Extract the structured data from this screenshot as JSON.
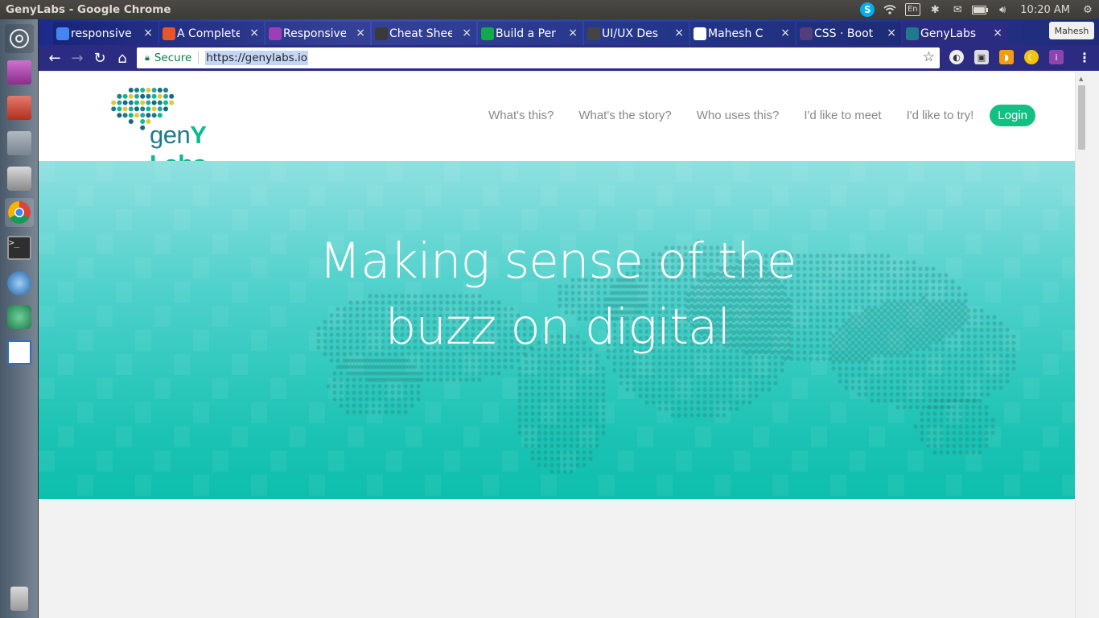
{
  "os": {
    "window_title": "GenyLabs - Google Chrome",
    "tray": {
      "language": "En",
      "clock": "10:20 AM"
    }
  },
  "browser": {
    "tabs": [
      {
        "label": "responsive",
        "favicon": "google-icon",
        "color": "#4285f4"
      },
      {
        "label": "A Complete",
        "favicon": "asterisk-icon",
        "color": "#e8552b"
      },
      {
        "label": "Responsive",
        "favicon": "purple-logo-icon",
        "color": "#9c3fb5"
      },
      {
        "label": "Cheat Sheet",
        "favicon": "vue-icon",
        "color": "#3a3a3a"
      },
      {
        "label": "Build a Per",
        "favicon": "codementor-icon",
        "color": "#14a84c"
      },
      {
        "label": "UI/UX Des",
        "favicon": "codepen-icon",
        "color": "#444"
      },
      {
        "label": "Mahesh C",
        "favicon": "document-icon",
        "color": "#ffffff"
      },
      {
        "label": "CSS · Boot",
        "favicon": "bootstrap-icon",
        "color": "#563d7c"
      },
      {
        "label": "GenyLabs",
        "favicon": "genylabs-icon",
        "color": "#1f7a8c"
      }
    ],
    "profile_name": "Mahesh",
    "secure_label": "Secure",
    "url": "https://genylabs.io"
  },
  "site": {
    "brand_prefix": "gen",
    "brand_strong": "Y Labs",
    "nav": [
      "What's this?",
      "What's the story?",
      "Who uses this?",
      "I'd like to meet",
      "I'd like to try!"
    ],
    "login_label": "Login",
    "hero_line1": "Making sense of the",
    "hero_line2": "buzz on digital",
    "accent": "#12c083",
    "hero_color": "#1cc3b4"
  }
}
